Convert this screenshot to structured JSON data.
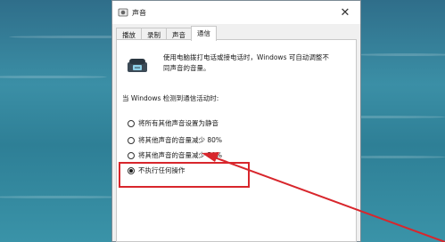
{
  "window": {
    "title": "声音",
    "close_glyph": "✕"
  },
  "tabs": [
    {
      "label": "播放",
      "active": false
    },
    {
      "label": "录制",
      "active": false
    },
    {
      "label": "声音",
      "active": false
    },
    {
      "label": "通信",
      "active": true
    }
  ],
  "communications": {
    "description": "使用电脑拨打电话或接电话时，Windows 可自动调整不同声音的音量。",
    "detect_label": "当 Windows 检测到通信活动时:",
    "options": [
      {
        "label": "将所有其他声音设置为静音",
        "selected": false
      },
      {
        "label": "将其他声音的音量减少 80%",
        "selected": false
      },
      {
        "label": "将其他声音的音量减少 50%",
        "selected": false
      },
      {
        "label": "不执行任何操作",
        "selected": true
      }
    ]
  },
  "annotation": {
    "color": "#d8262c"
  },
  "icons": [
    "speaker-icon",
    "close-icon",
    "telephone-icon"
  ]
}
